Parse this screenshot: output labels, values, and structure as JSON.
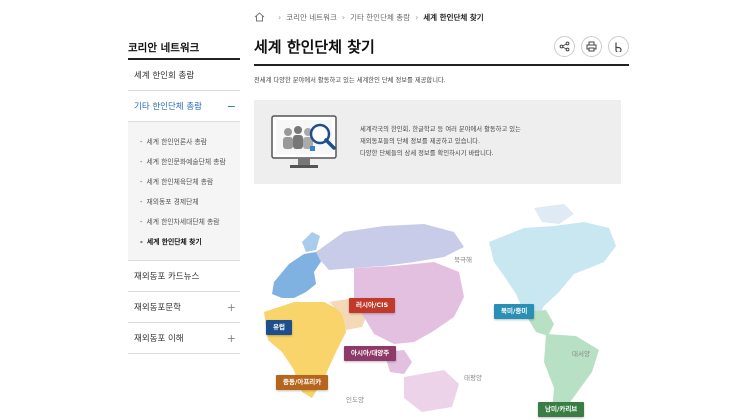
{
  "breadcrumb": {
    "items": [
      "코리안 네트워크",
      "기타 한인단체 총람"
    ],
    "current": "세계 한인단체 찾기"
  },
  "sidebar": {
    "title": "코리안 네트워크",
    "items": [
      {
        "label": "세계 한인회 총람"
      },
      {
        "label": "기타 한인단체 총람",
        "toggle": "−"
      },
      {
        "label": "재외동포 카드뉴스"
      },
      {
        "label": "재외동포문학",
        "toggle": "+"
      },
      {
        "label": "재외동포 이해",
        "toggle": "+"
      }
    ],
    "sub_items": [
      "세계 한인언론사 총람",
      "세계 한인문화예술단체 총람",
      "세계 한인체육단체 총람",
      "재외동포 경제단체",
      "세계 한인차세대단체 총람",
      "세계 한인단체 찾기"
    ],
    "sub_dash": "-"
  },
  "main": {
    "title": "세계 한인단체 찾기",
    "intro": "전세계 다양한 분야에서 활동하고 있는 세계한인 단체 정보를 제공합니다.",
    "info_lines": [
      "세계각국의 한인회, 한글학교 등 여러 분야에서 활동하고 있는",
      "재외동포들의 단체 정보를 제공하고 있습니다.",
      "다양한 단체들의 상세 정보를 확인하시기 바랍니다."
    ]
  },
  "map": {
    "regions": {
      "europe": "유럽",
      "russia": "러시아/CIS",
      "asia": "아시아/대양주",
      "mideast": "중동/아프리카",
      "namerica": "북미/중미",
      "samerica": "남미/카리브"
    },
    "oceans": {
      "arctic": "북극해",
      "pacific": "태평양",
      "atlantic": "대서양",
      "indian": "인도양"
    },
    "colors": {
      "europe": "#1f4e8c",
      "russia": "#c0392b",
      "asia": "#8e3a68",
      "mideast": "#b5651d",
      "namerica": "#2a8fb5",
      "samerica": "#3a7d44"
    }
  }
}
